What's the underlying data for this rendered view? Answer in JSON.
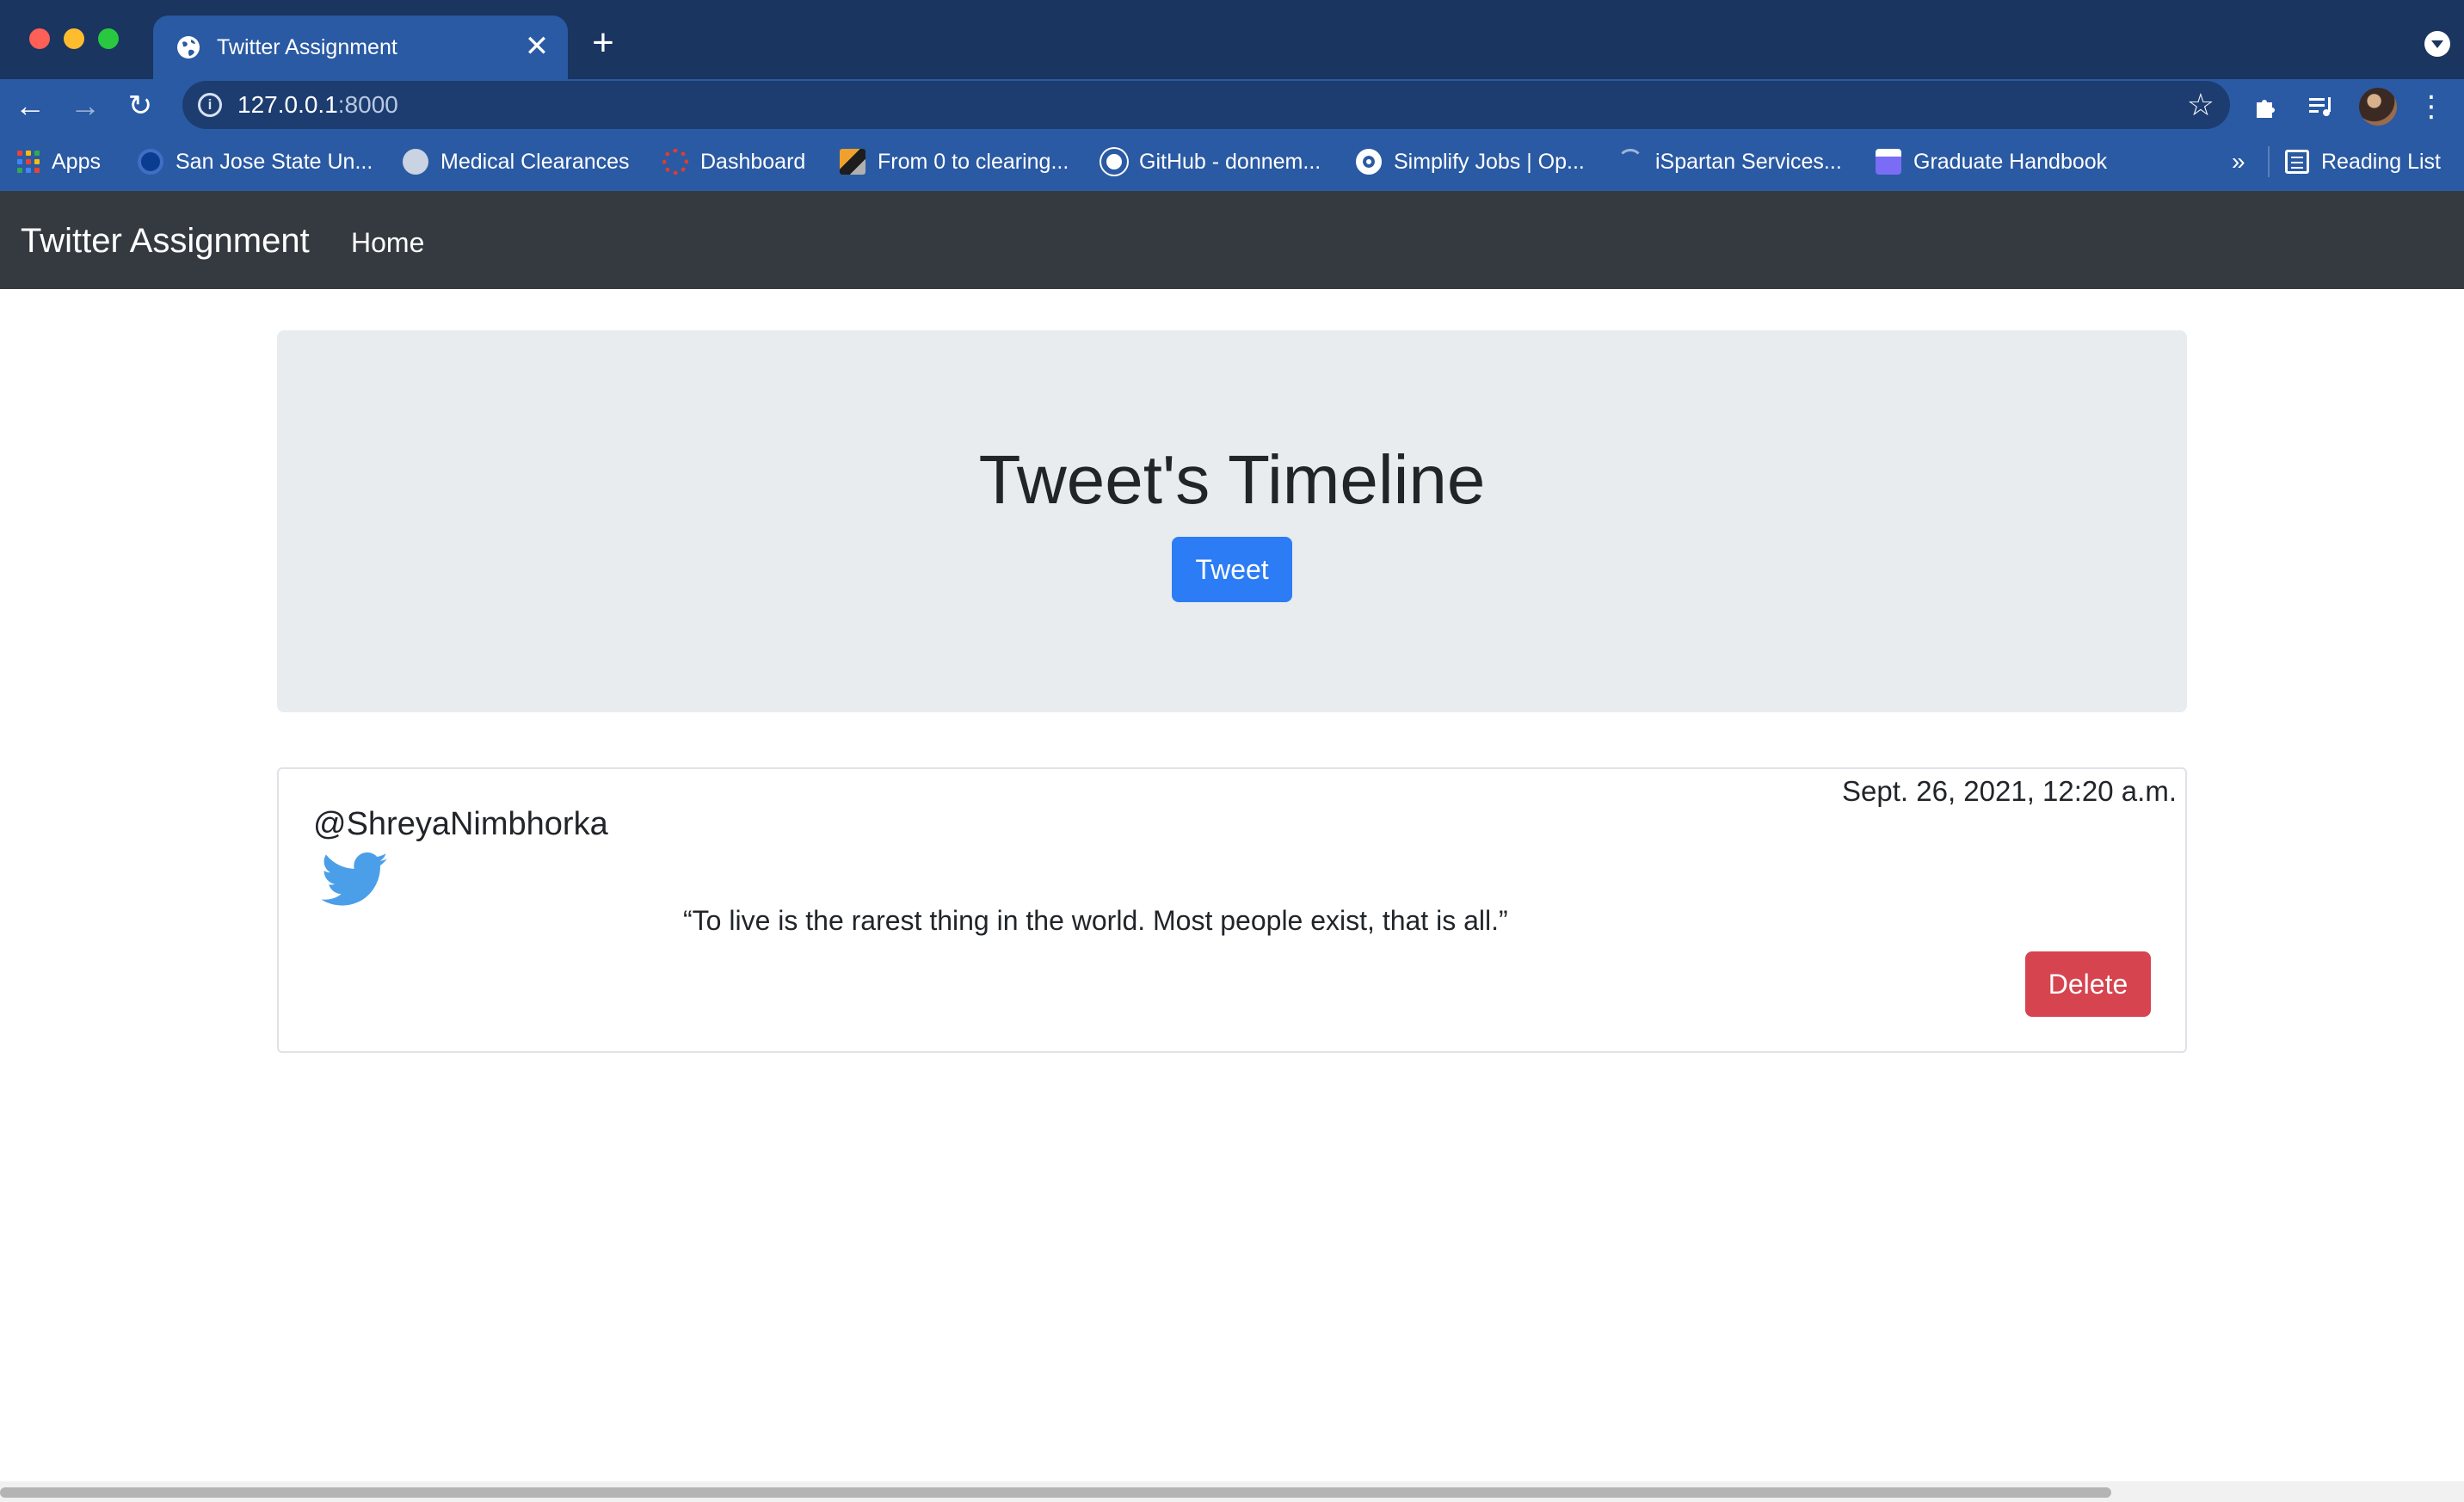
{
  "browser": {
    "tab": {
      "title": "Twitter Assignment",
      "close_glyph": "✕",
      "favicon": "globe-icon"
    },
    "new_tab_glyph": "+",
    "nav": {
      "back": "←",
      "forward": "→",
      "reload": "↻"
    },
    "omnibox": {
      "host": "127.0.0.1",
      "port": ":8000",
      "info_glyph": "i",
      "star_glyph": "☆"
    },
    "toolbar_icons": {
      "extensions": "puzzle-icon",
      "media": "media-control-icon",
      "menu_glyph": "⋮"
    },
    "bookmarks": [
      {
        "label": "Apps",
        "icon": "apps-grid-icon"
      },
      {
        "label": "San Jose State Un...",
        "icon": "sjsu-icon",
        "color": "#0a3d8f"
      },
      {
        "label": "Medical Clearances",
        "icon": "globe-icon",
        "color": "#c9d3e1"
      },
      {
        "label": "Dashboard",
        "icon": "canvas-icon",
        "color": "#e03c2f"
      },
      {
        "label": "From 0 to clearing...",
        "icon": "leetcode-icon",
        "color": "#f0a02c"
      },
      {
        "label": "GitHub - donnem...",
        "icon": "github-icon",
        "color": "#ffffff"
      },
      {
        "label": "Simplify Jobs | Op...",
        "icon": "simplify-icon",
        "color": "#ffffff"
      },
      {
        "label": "iSpartan Services...",
        "icon": "loading-icon",
        "color": "#9fb6d9"
      },
      {
        "label": "Graduate Handbook",
        "icon": "handbook-icon",
        "color": "#7b6cf5"
      }
    ],
    "bookmarks_more": "»",
    "reading_list": "Reading List"
  },
  "navbar": {
    "brand": "Twitter Assignment",
    "home": "Home"
  },
  "jumbotron": {
    "title": "Tweet's Timeline",
    "button": "Tweet"
  },
  "tweet": {
    "username": "@ShreyaNimbhorka",
    "timestamp": "Sept. 26, 2021, 12:20 a.m.",
    "text": "“To live is the rarest thing in the world. Most people exist, that is all.”",
    "delete": "Delete",
    "bird_color": "#4a9fe8"
  },
  "colors": {
    "navbar": "#343a40",
    "primary": "#2c7cf5",
    "danger": "#d6444f",
    "jumbotron": "#e9ecef"
  }
}
